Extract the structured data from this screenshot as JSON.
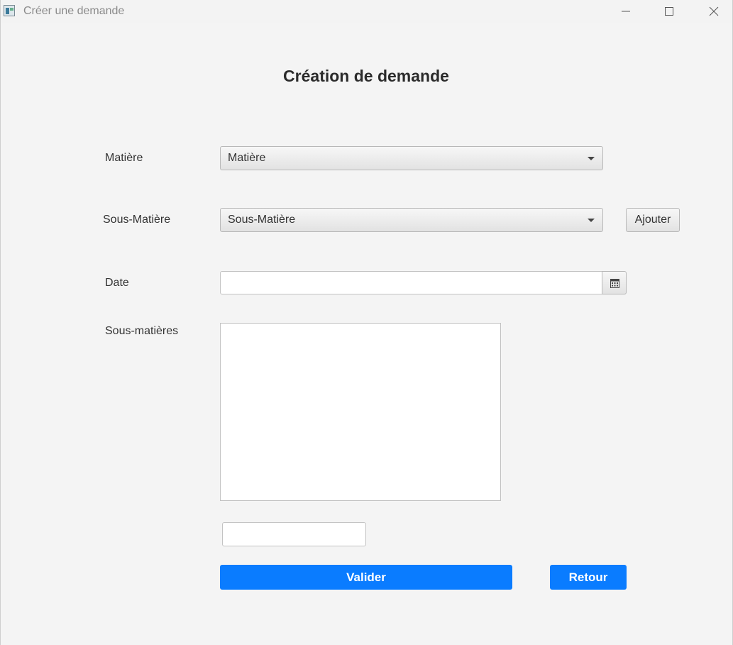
{
  "window": {
    "title": "Créer une demande",
    "controls": [
      "minimize-icon",
      "maximize-icon",
      "close-icon"
    ]
  },
  "page": {
    "heading": "Création de demande"
  },
  "form": {
    "matiere": {
      "label": "Matière",
      "selected": "Matière"
    },
    "sous_matiere": {
      "label": "Sous-Matière",
      "selected": "Sous-Matière",
      "add_button": "Ajouter"
    },
    "date": {
      "label": "Date",
      "value": "",
      "picker_icon": "calendar-icon"
    },
    "sous_matieres_list": {
      "label": "Sous-matières",
      "items": []
    },
    "extra_input": {
      "value": ""
    }
  },
  "actions": {
    "submit": "Valider",
    "back": "Retour"
  },
  "colors": {
    "primary": "#0a7cff",
    "background": "#f4f4f4"
  }
}
